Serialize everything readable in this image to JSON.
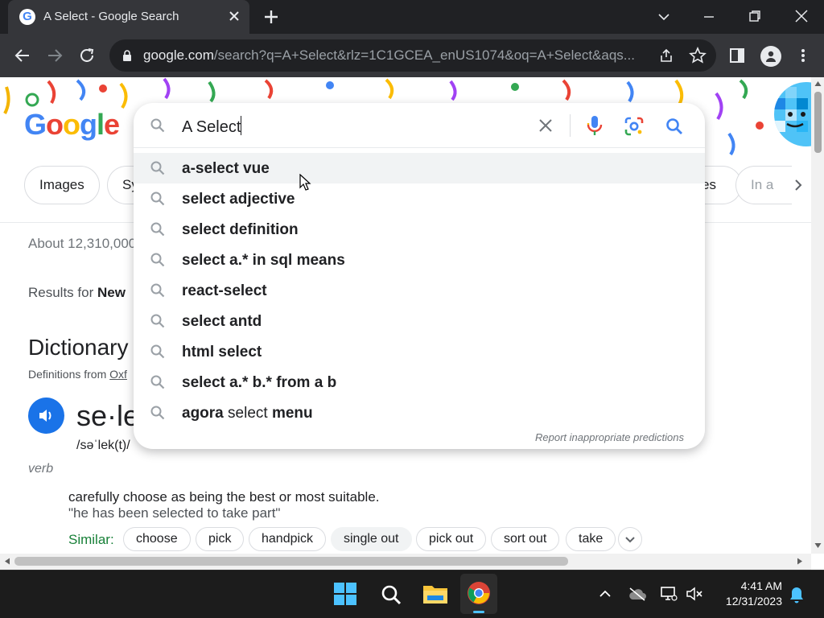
{
  "browser": {
    "tab_title": "A Select - Google Search",
    "url_host": "google.com",
    "url_rest": "/search?q=A+Select&rlz=1C1GCEA_enUS1074&oq=A+Select&aqs..."
  },
  "search": {
    "query": "A Select",
    "suggestions": [
      {
        "bold": "a-select vue",
        "normal": "",
        "tail": ""
      },
      {
        "bold": "select adjective",
        "normal": "",
        "tail": ""
      },
      {
        "bold": "select definition",
        "normal": "",
        "tail": ""
      },
      {
        "bold": "select a.* in sql means",
        "normal": "",
        "tail": ""
      },
      {
        "bold": "react-select",
        "normal": "",
        "tail": ""
      },
      {
        "bold": "select antd",
        "normal": "",
        "tail": ""
      },
      {
        "bold": "html select",
        "normal": "",
        "tail": ""
      },
      {
        "bold": "select a.* b.* from a b",
        "normal": "",
        "tail": ""
      },
      {
        "bold": "agora",
        "normal": " select ",
        "tail": "menu"
      }
    ],
    "report_link": "Report inappropriate predictions"
  },
  "filters": {
    "images": "Images",
    "sy_partial": "Sy",
    "es_partial": "es",
    "ina_partial": "In a"
  },
  "results": {
    "stats": "About 12,310,000",
    "results_for_prefix": "Results for ",
    "results_for_place": "New "
  },
  "dictionary": {
    "title": "Dictionary",
    "source_prefix": "Definitions from ",
    "source_name": "Oxf",
    "word": "se·le",
    "phonetic": "/səˈlek(t)/",
    "part_of_speech": "verb",
    "definition": "carefully choose as being the best or most suitable.",
    "example": "\"he has been selected to take part\"",
    "similar_label": "Similar:",
    "similar": [
      "choose",
      "pick",
      "handpick",
      "single out",
      "pick out",
      "sort out",
      "take"
    ]
  },
  "taskbar": {
    "time": "4:41 AM",
    "date": "12/31/2023"
  },
  "colors": {
    "google_blue": "#4285f4",
    "google_red": "#ea4335",
    "google_yellow": "#fbbc05",
    "google_green": "#34a853",
    "accent_blue": "#1a73e8",
    "similar_green": "#188038"
  }
}
